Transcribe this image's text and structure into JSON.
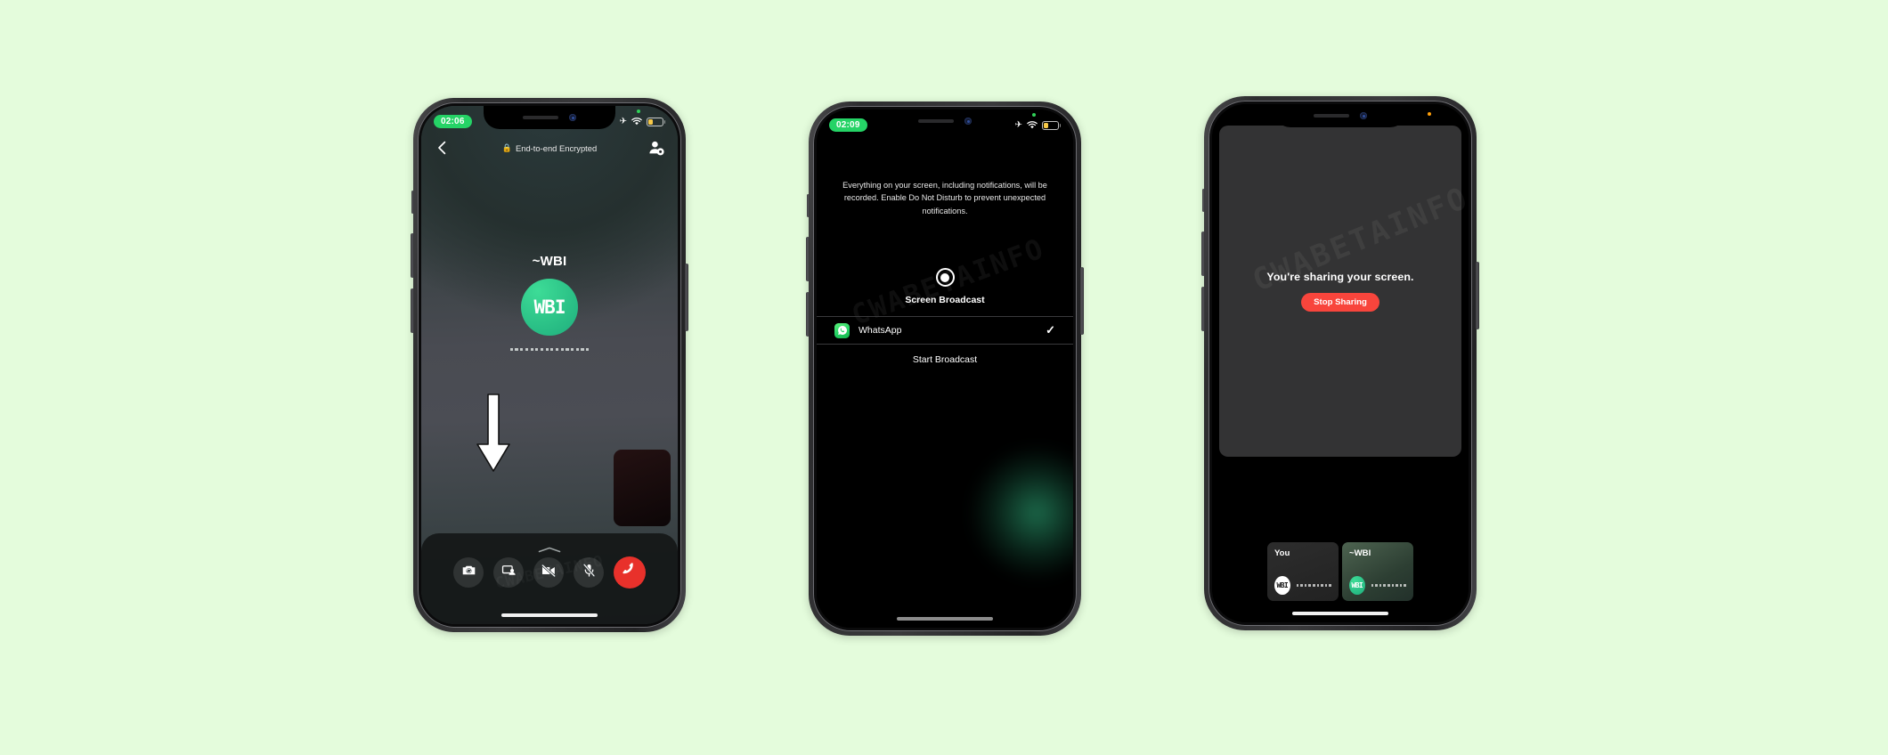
{
  "page": {
    "background_color": "#e4fcdc",
    "watermark": "CWABETAINFO"
  },
  "phone1": {
    "status_bar": {
      "time": "02:06",
      "airplane_icon": "airplane-mode-icon",
      "wifi_icon": "wifi-icon",
      "battery_icon": "battery-low-icon",
      "recording_dot": "green-recording-indicator"
    },
    "header": {
      "back_icon": "back-chevron-icon",
      "lock_icon": "lock-icon",
      "title": "End-to-end Encrypted",
      "add_participant_icon": "add-participant-icon"
    },
    "caller": {
      "name": "~WBI",
      "avatar_initials": "WBI",
      "avatar_color": "#25d366",
      "redacted_status": "redacted-dots"
    },
    "pip": {
      "label": "self-video-thumbnail"
    },
    "annotation": {
      "arrow": "down-arrow-annotation"
    },
    "toolbar": {
      "grabber": "drag-handle",
      "buttons": [
        {
          "name": "flip-camera-button",
          "icon": "camera-flip-icon"
        },
        {
          "name": "share-screen-button",
          "icon": "screen-share-icon"
        },
        {
          "name": "video-off-button",
          "icon": "video-camera-off-icon"
        },
        {
          "name": "mute-mic-button",
          "icon": "microphone-muted-icon"
        },
        {
          "name": "end-call-button",
          "icon": "phone-hangup-icon",
          "color": "#e8312b"
        }
      ]
    }
  },
  "phone2": {
    "status_bar": {
      "time": "02:09",
      "airplane_icon": "airplane-mode-icon",
      "wifi_icon": "wifi-icon",
      "battery_icon": "battery-low-icon",
      "recording_dot": "green-recording-indicator"
    },
    "notice": "Everything on your screen, including notifications, will be recorded. Enable Do Not Disturb to prevent unexpected notifications.",
    "broadcast": {
      "record_icon": "record-circle-icon",
      "title": "Screen Broadcast",
      "app_row": {
        "app_icon": "whatsapp-icon",
        "app_name": "WhatsApp",
        "selected_mark": "✓"
      },
      "start_label": "Start Broadcast"
    }
  },
  "phone3": {
    "status_bar": {
      "recording_dot": "orange-privacy-indicator"
    },
    "share": {
      "message": "You're sharing your screen.",
      "stop_label": "Stop Sharing",
      "stop_color": "#f8453c"
    },
    "tiles": [
      {
        "name": "You",
        "avatar_initials": "WBI",
        "avatar_style": "white",
        "status": "redacted-dots"
      },
      {
        "name": "~WBI",
        "avatar_initials": "WBI",
        "avatar_style": "green",
        "status": "redacted-dots"
      }
    ]
  }
}
